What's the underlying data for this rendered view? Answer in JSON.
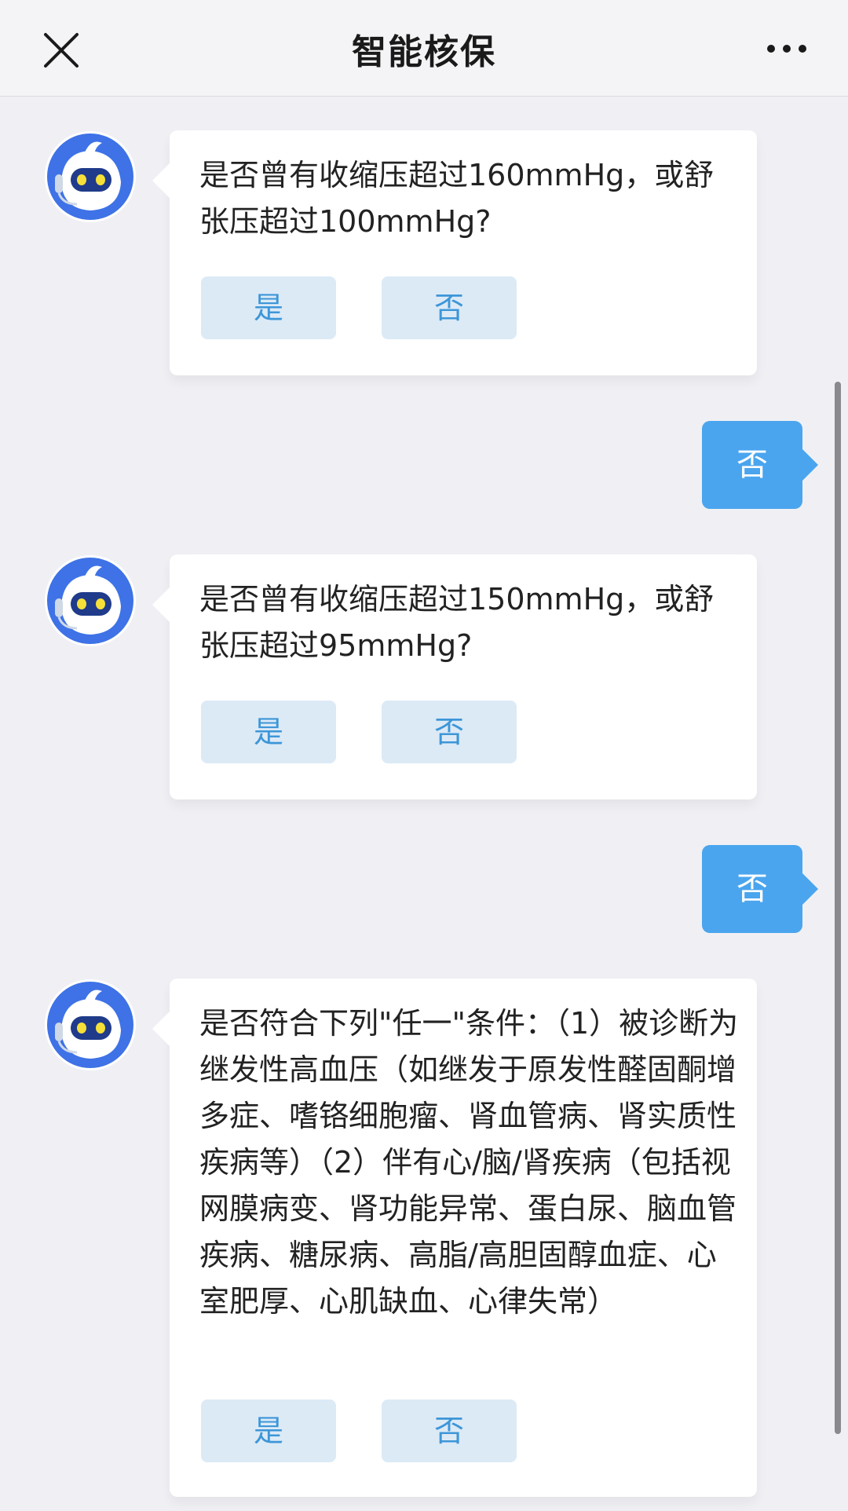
{
  "header": {
    "title": "智能核保",
    "close_icon": "close-icon",
    "more_icon": "more-icon"
  },
  "messages": [
    {
      "question": "是否曾有收缩压超过160mmHg，或舒张压超过100mmHg?",
      "yes": "是",
      "no": "否"
    },
    {
      "reply": "否"
    },
    {
      "question": "是否曾有收缩压超过150mmHg，或舒张压超过95mmHg?",
      "yes": "是",
      "no": "否"
    },
    {
      "reply": "否"
    },
    {
      "question": "是否符合下列\"任一\"条件：（1）被诊断为继发性高血压（如继发于原发性醛固酮增多症、嗜铬细胞瘤、肾血管病、肾实质性疾病等）（2）伴有心/脑/肾疾病（包括视网膜病变、肾功能异常、蛋白尿、脑血管疾病、糖尿病、高脂/高胆固醇血症、心室肥厚、心肌缺血、心律失常）",
      "yes": "是",
      "no": "否"
    }
  ],
  "colors": {
    "accent": "#4aa5ee",
    "option_bg": "#dceaf6",
    "option_text": "#3d96d8",
    "background": "#f0f0f4"
  }
}
